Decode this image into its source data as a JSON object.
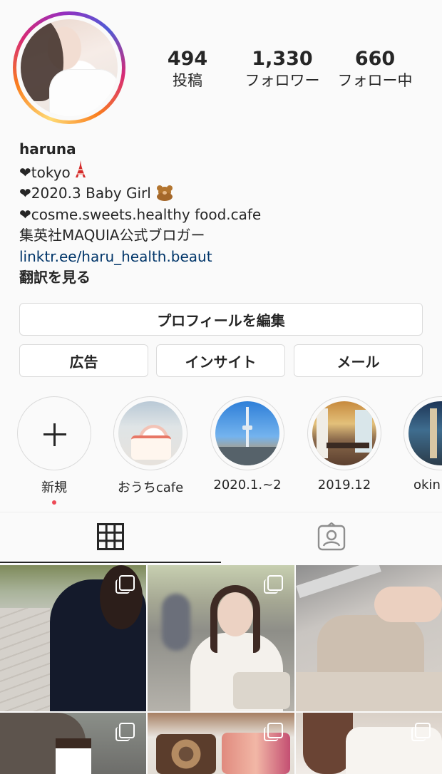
{
  "profile": {
    "username": "haruna",
    "stats": {
      "posts": {
        "value": "494",
        "label": "投稿"
      },
      "followers": {
        "value": "1,330",
        "label": "フォロワー"
      },
      "following": {
        "value": "660",
        "label": "フォロー中"
      }
    },
    "bio": {
      "line1": "❤tokyo",
      "line1_emoji": "tokyo-tower-icon",
      "line2": "❤2020.3 Baby Girl",
      "line2_emoji": "teddy-bear-icon",
      "line3": "❤cosme.sweets.healthy food.cafe",
      "line4": "集英社MAQUIA公式ブロガー",
      "link": "linktr.ee/haru_health.beaut",
      "translate": "翻訳を見る"
    }
  },
  "buttons": {
    "edit_profile": "プロフィールを編集",
    "ads": "広告",
    "insights": "インサイト",
    "email": "メール"
  },
  "highlights": [
    {
      "label": "新規",
      "icon": "plus-icon"
    },
    {
      "label": "おうちcafe"
    },
    {
      "label": "2020.1.~2"
    },
    {
      "label": "2019.12"
    },
    {
      "label": "okin"
    }
  ],
  "tabs": [
    {
      "name": "posts-grid",
      "icon": "grid-icon",
      "active": true
    },
    {
      "name": "tagged",
      "icon": "tagged-person-icon",
      "active": false
    }
  ],
  "colors": {
    "accent_link": "#003569",
    "notification_dot": "#ed4956",
    "text": "#262626",
    "border": "#dbdbdb"
  }
}
